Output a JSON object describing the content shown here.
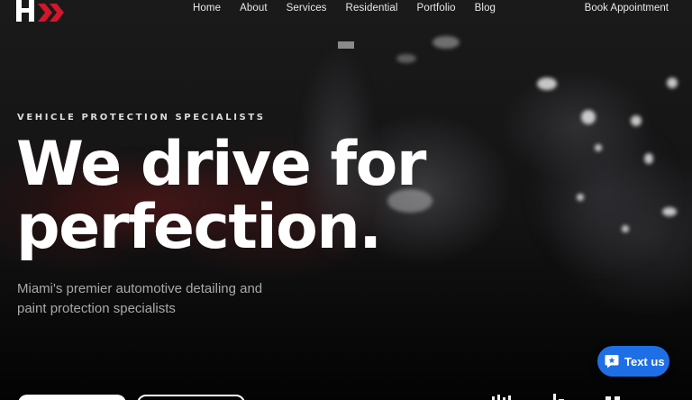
{
  "nav": {
    "logo_icon": "h-double-chevron-logo",
    "links": [
      "Home",
      "About",
      "Services",
      "Residential",
      "Portfolio",
      "Blog"
    ],
    "book_label": "Book Appointment"
  },
  "hero": {
    "eyebrow": "VEHICLE PROTECTION SPECIALISTS",
    "headline_line1": "We drive for",
    "headline_line2": "perfection.",
    "subhead": "Miami's premier automotive detailing and paint protection specialists"
  },
  "widget": {
    "label": "Text us",
    "icon": "chat-bubble-icon",
    "color": "#1e6fe6"
  },
  "colors": {
    "accent_red": "#d3162a",
    "text_muted": "#a9a9a9"
  }
}
